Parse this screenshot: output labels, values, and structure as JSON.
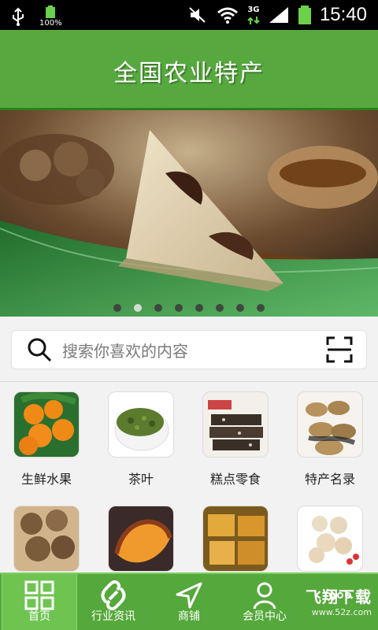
{
  "status": {
    "battery_small": "100%",
    "network": "3G",
    "time": "15:40"
  },
  "header": {
    "title": "全国农业特产"
  },
  "carousel": {
    "total_pages": 8,
    "active_index": 1
  },
  "search": {
    "placeholder": "搜索你喜欢的内容"
  },
  "categories": [
    {
      "label": "生鲜水果",
      "icon": "fruit-oranges"
    },
    {
      "label": "茶叶",
      "icon": "tea"
    },
    {
      "label": "糕点零食",
      "icon": "pastry-snacks"
    },
    {
      "label": "特产名录",
      "icon": "peanuts-specialty"
    },
    {
      "label": "",
      "icon": "dried-fruit"
    },
    {
      "label": "",
      "icon": "sweet-potato"
    },
    {
      "label": "",
      "icon": "dried-goods"
    },
    {
      "label": "",
      "icon": "lotus-seeds"
    }
  ],
  "tabs": [
    {
      "label": "首页",
      "icon": "grid-icon"
    },
    {
      "label": "行业资讯",
      "icon": "link-icon"
    },
    {
      "label": "商铺",
      "icon": "navigation-icon"
    },
    {
      "label": "会员中心",
      "icon": "user-icon"
    },
    {
      "label": "",
      "icon": "more-icon"
    }
  ],
  "watermark": {
    "line1": "飞翔下载",
    "line2": "www.52z.com"
  },
  "colors": {
    "green": "#57a83f",
    "green_dark": "#2f7d1b",
    "tab_active": "#6fc451"
  }
}
